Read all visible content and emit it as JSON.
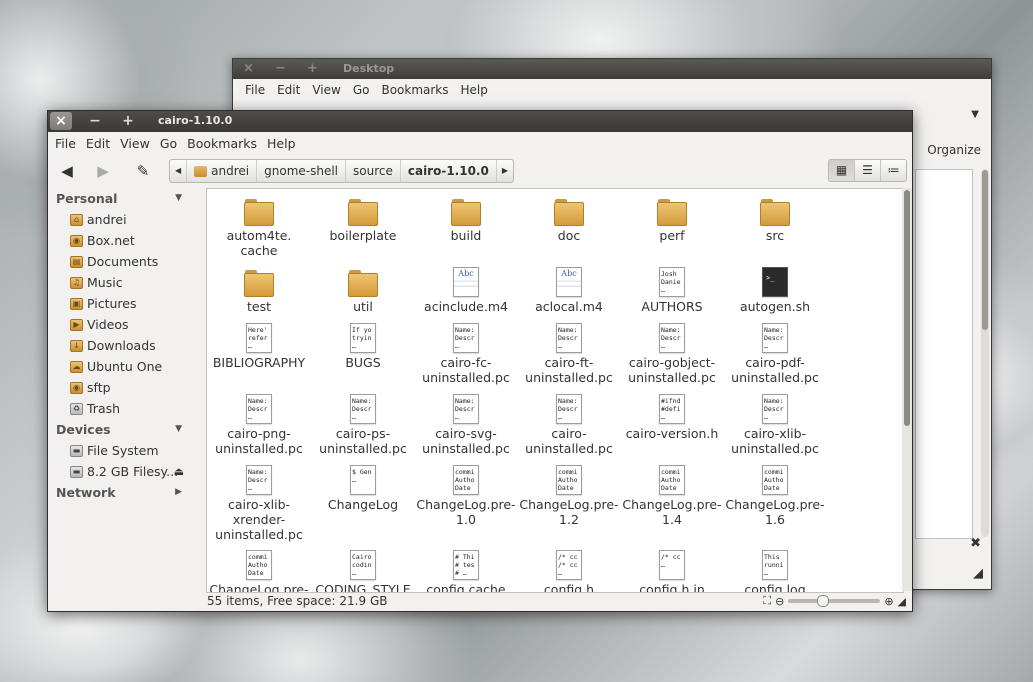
{
  "back_window": {
    "title": "Desktop",
    "menu": [
      "File",
      "Edit",
      "View",
      "Go",
      "Bookmarks",
      "Help"
    ],
    "organize_label": "Organize",
    "close_symbol": "×",
    "min_symbol": "−",
    "max_symbol": "+"
  },
  "front_window": {
    "title": "cairo-1.10.0",
    "close_symbol": "×",
    "min_symbol": "−",
    "max_symbol": "+"
  },
  "menu": [
    "File",
    "Edit",
    "View",
    "Go",
    "Bookmarks",
    "Help"
  ],
  "toolbar": {
    "back_icon": "back-arrow-icon",
    "forward_icon": "forward-arrow-icon",
    "edit_icon": "pencil-icon",
    "breadcrumbs": [
      "andrei",
      "gnome-shell",
      "source",
      "cairo-1.10.0"
    ],
    "view_modes": [
      "icon-view-icon",
      "list-view-icon",
      "compact-view-icon"
    ]
  },
  "sidebar": {
    "personal_label": "Personal",
    "personal_items": [
      "andrei",
      "Box.net",
      "Documents",
      "Music",
      "Pictures",
      "Videos",
      "Downloads",
      "Ubuntu One",
      "sftp",
      "Trash"
    ],
    "devices_label": "Devices",
    "device_items": [
      "File System",
      "8.2 GB Filesy..."
    ],
    "network_label": "Network"
  },
  "files": [
    {
      "name": "autom4te.\ncache",
      "type": "folder"
    },
    {
      "name": "boilerplate",
      "type": "folder"
    },
    {
      "name": "build",
      "type": "folder"
    },
    {
      "name": "doc",
      "type": "folder"
    },
    {
      "name": "perf",
      "type": "folder"
    },
    {
      "name": "src",
      "type": "folder"
    },
    {
      "name": "test",
      "type": "folder"
    },
    {
      "name": "util",
      "type": "folder"
    },
    {
      "name": "acinclude.m4",
      "type": "abc"
    },
    {
      "name": "aclocal.m4",
      "type": "abc"
    },
    {
      "name": "AUTHORS",
      "type": "text",
      "preview": "Josh\nDanie\n…"
    },
    {
      "name": "autogen.sh",
      "type": "term",
      "preview": ">_"
    },
    {
      "name": "BIBLIOGRAPHY",
      "type": "text",
      "preview": "Here'\nrefer\n…"
    },
    {
      "name": "BUGS",
      "type": "text",
      "preview": "If yo\ntryin\n…"
    },
    {
      "name": "cairo-fc-\nuninstalled.pc",
      "type": "text",
      "preview": "Name:\nDescr\n…"
    },
    {
      "name": "cairo-ft-\nuninstalled.pc",
      "type": "text",
      "preview": "Name:\nDescr\n…"
    },
    {
      "name": "cairo-gobject-\nuninstalled.pc",
      "type": "text",
      "preview": "Name:\nDescr\n…"
    },
    {
      "name": "cairo-pdf-\nuninstalled.pc",
      "type": "text",
      "preview": "Name:\nDescr\n…"
    },
    {
      "name": "cairo-png-\nuninstalled.pc",
      "type": "text",
      "preview": "Name:\nDescr\n…"
    },
    {
      "name": "cairo-ps-\nuninstalled.pc",
      "type": "text",
      "preview": "Name:\nDescr\n…"
    },
    {
      "name": "cairo-svg-\nuninstalled.pc",
      "type": "text",
      "preview": "Name:\nDescr\n…"
    },
    {
      "name": "cairo-\nuninstalled.pc",
      "type": "text",
      "preview": "Name:\nDescr\n…"
    },
    {
      "name": "cairo-version.h",
      "type": "text",
      "preview": "#ifnd\n#defi\n…"
    },
    {
      "name": "cairo-xlib-\nuninstalled.pc",
      "type": "text",
      "preview": "Name:\nDescr\n…"
    },
    {
      "name": "cairo-xlib-\nxrender-\nuninstalled.pc",
      "type": "text",
      "preview": "Name:\nDescr\n…"
    },
    {
      "name": "ChangeLog",
      "type": "text",
      "preview": "$ Gen\n…"
    },
    {
      "name": "ChangeLog.pre-\n1.0",
      "type": "text",
      "preview": "commi\nAutho\nDate"
    },
    {
      "name": "ChangeLog.pre-\n1.2",
      "type": "text",
      "preview": "commi\nAutho\nDate"
    },
    {
      "name": "ChangeLog.pre-\n1.4",
      "type": "text",
      "preview": "commi\nAutho\nDate"
    },
    {
      "name": "ChangeLog.pre-\n1.6",
      "type": "text",
      "preview": "commi\nAutho\nDate"
    },
    {
      "name": "ChangeLog.pre-",
      "type": "text",
      "preview": "commi\nAutho\nDate"
    },
    {
      "name": "CODING_STYLE",
      "type": "text",
      "preview": "Cairo\ncodin\n…"
    },
    {
      "name": "config.cache",
      "type": "text",
      "preview": "# Thi\n# tes\n# …"
    },
    {
      "name": "config.h",
      "type": "text",
      "preview": "/* cc\n/* cc\n…"
    },
    {
      "name": "config.h.in",
      "type": "text",
      "preview": "/* cc\n…"
    },
    {
      "name": "config.log",
      "type": "text",
      "preview": "This\nrunni\n…"
    }
  ],
  "status": {
    "text": "55 items, Free space: 21.9 GB",
    "zoom_level": 0.35
  }
}
